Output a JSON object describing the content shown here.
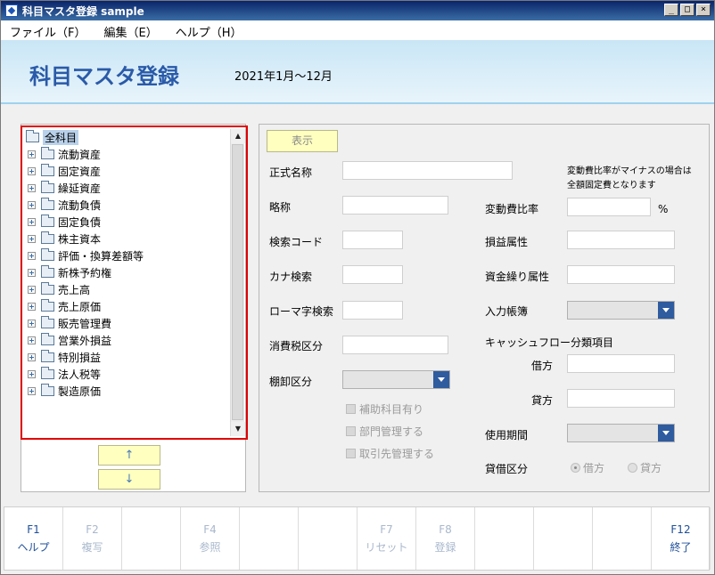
{
  "window": {
    "title": "科目マスタ登録 sample",
    "min": "_",
    "max": "□",
    "close": "×"
  },
  "menu": [
    {
      "label": "ファイル（F）"
    },
    {
      "label": "編集（E）"
    },
    {
      "label": "ヘルプ（H）"
    }
  ],
  "header": {
    "title": "科目マスタ登録",
    "period": "2021年1月～12月"
  },
  "tree": {
    "root": "全科目",
    "items": [
      "流動資産",
      "固定資産",
      "繰延資産",
      "流動負債",
      "固定負債",
      "株主資本",
      "評価・換算差額等",
      "新株予約権",
      "売上高",
      "売上原価",
      "販売管理費",
      "営業外損益",
      "特別損益",
      "法人税等",
      "製造原価"
    ]
  },
  "scroll": {
    "up": "▲",
    "down": "▼"
  },
  "move_buttons": {
    "up": "↑",
    "down": "↓"
  },
  "form": {
    "show_button": "表示",
    "official_name": "正式名称",
    "short_name": "略称",
    "search_code": "検索コード",
    "kana_search": "カナ検索",
    "romaji_search": "ローマ字検索",
    "tax_category": "消費税区分",
    "inventory_category": "棚卸区分",
    "variable_cost_ratio": "変動費比率",
    "percent": "%",
    "note_line1": "変動費比率がマイナスの場合は",
    "note_line2": "全額固定費となります",
    "pl_attribute": "損益属性",
    "cash_attribute": "資金繰り属性",
    "input_book": "入力帳簿",
    "cashflow_title": "キャッシュフロー分類項目",
    "debit": "借方",
    "credit": "貸方",
    "period_of_use": "使用期間",
    "balance_category": "貸借区分",
    "radio_debit": "借方",
    "radio_credit": "貸方",
    "chk_sub_account": "補助科目有り",
    "chk_department": "部門管理する",
    "chk_partner": "取引先管理する"
  },
  "fkeys": [
    {
      "key": "F1",
      "name": "ヘルプ",
      "enabled": true
    },
    {
      "key": "F2",
      "name": "複写",
      "enabled": false
    },
    {
      "key": "",
      "name": "",
      "enabled": false
    },
    {
      "key": "F4",
      "name": "参照",
      "enabled": false
    },
    {
      "key": "",
      "name": "",
      "enabled": false
    },
    {
      "key": "",
      "name": "",
      "enabled": false
    },
    {
      "key": "F7",
      "name": "リセット",
      "enabled": false
    },
    {
      "key": "F8",
      "name": "登録",
      "enabled": false
    },
    {
      "key": "",
      "name": "",
      "enabled": false
    },
    {
      "key": "",
      "name": "",
      "enabled": false
    },
    {
      "key": "",
      "name": "",
      "enabled": false
    },
    {
      "key": "F12",
      "name": "終了",
      "enabled": true
    }
  ],
  "colors": {
    "accent": "#2a5aa8",
    "highlight_frame": "#e00000",
    "button_bg": "#ffffc0"
  }
}
